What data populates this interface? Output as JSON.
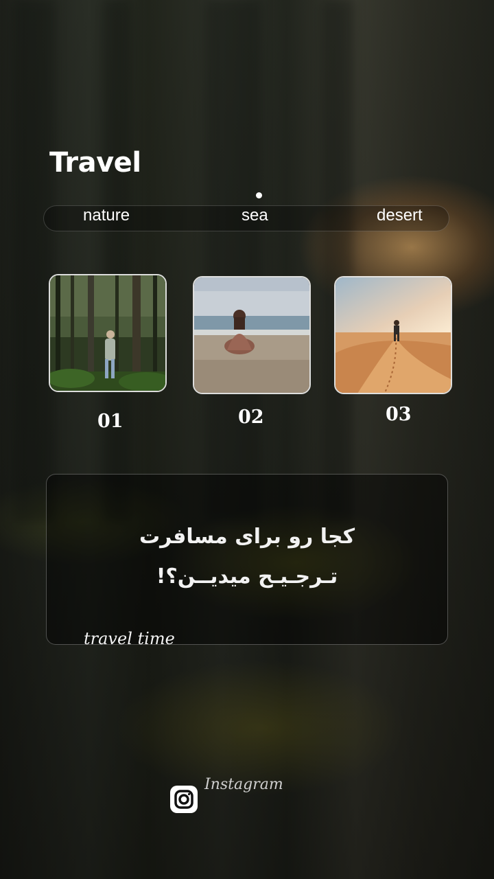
{
  "title": "Travel",
  "tabs": [
    {
      "label": "nature"
    },
    {
      "label": "sea"
    },
    {
      "label": "desert"
    }
  ],
  "cards": [
    {
      "number": "01",
      "scene": "forest-hiker"
    },
    {
      "number": "02",
      "scene": "beach-sitting-woman"
    },
    {
      "number": "03",
      "scene": "desert-dune-walker"
    }
  ],
  "question": {
    "line1": "کجا رو برای مسافرت",
    "line2": "تـرجـیـح میدیــن؟!"
  },
  "tagline": "travel time",
  "social": {
    "label": "Instagram",
    "icon": "instagram-icon"
  },
  "colors": {
    "text": "#ffffff",
    "sunlight": "#ffbe6e",
    "panel": "rgba(0,0,0,0.45)"
  }
}
